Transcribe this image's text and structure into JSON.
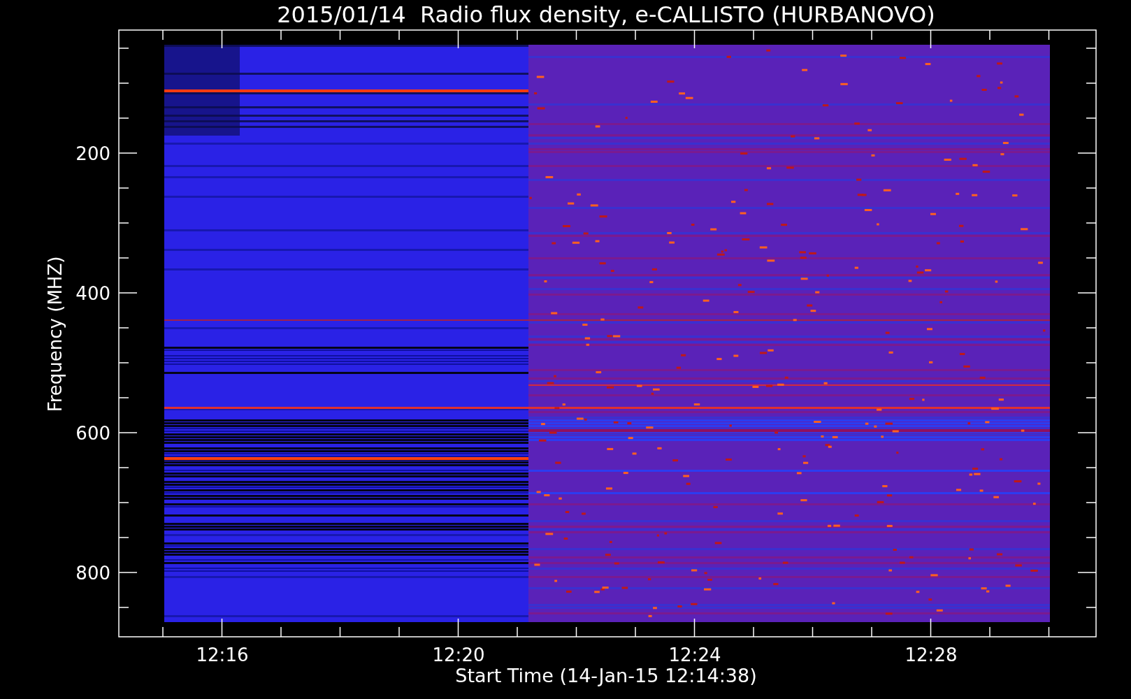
{
  "title": "2015/01/14  Radio flux density, e-CALLISTO (HURBANOVO)",
  "ylabel": "Frequency (MHZ)",
  "xlabel": "Start Time (14-Jan-15 12:14:38)",
  "yticks": [
    "200",
    "400",
    "600",
    "800"
  ],
  "xticks": [
    "12:16",
    "12:20",
    "12:24",
    "12:28"
  ]
}
